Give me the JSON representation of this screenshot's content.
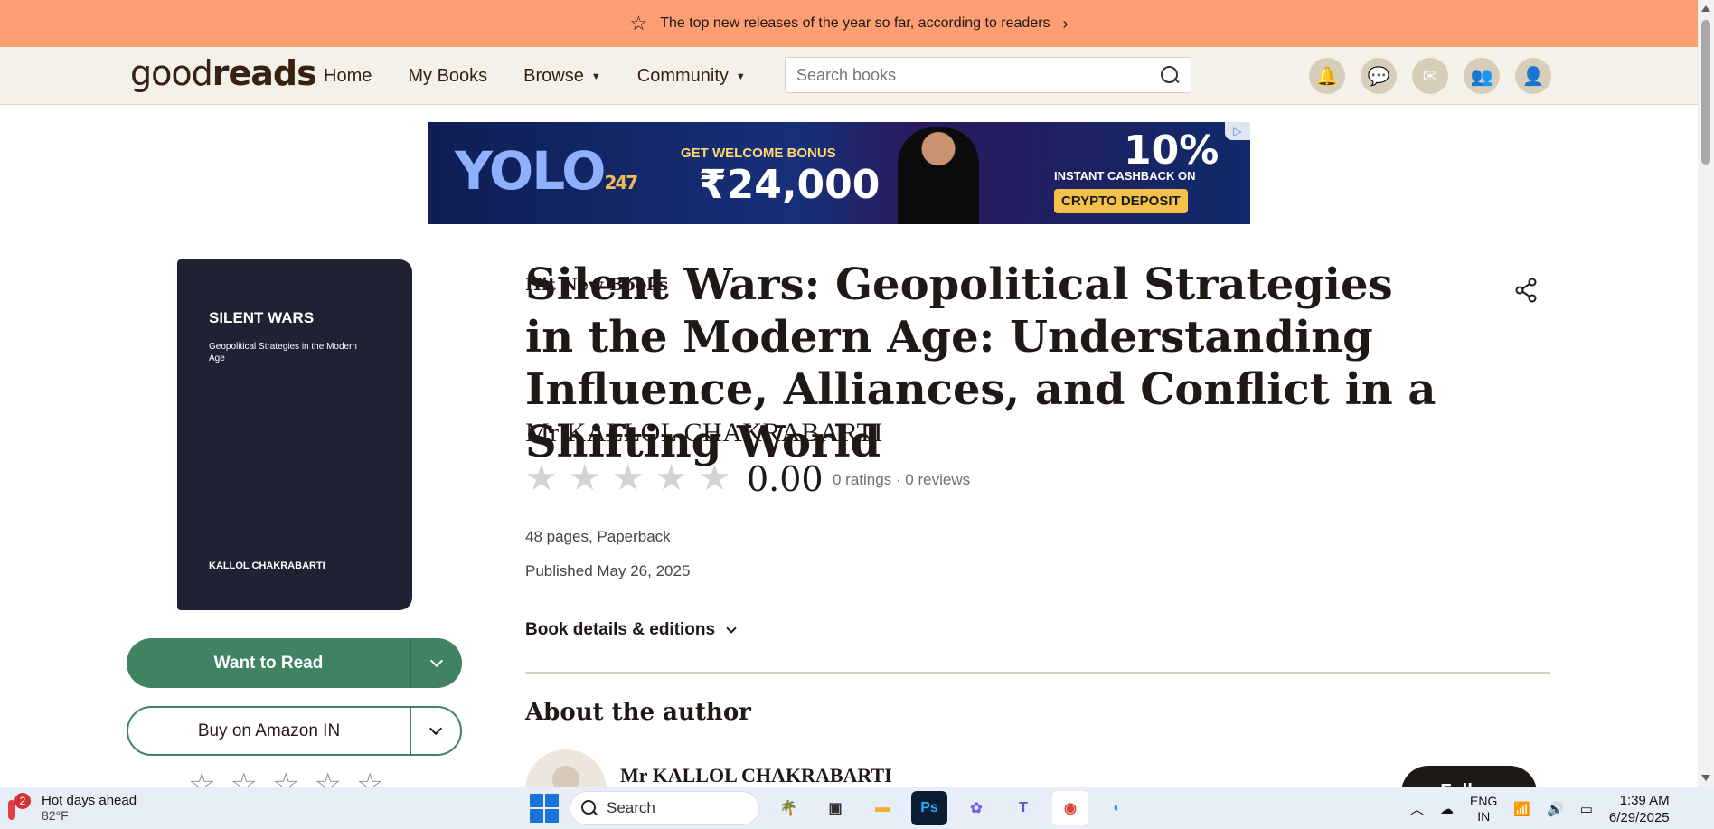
{
  "promo": {
    "title": "Hit New Books",
    "subtitle": "The top new releases of the year so far, according to readers"
  },
  "header": {
    "logo_light": "good",
    "logo_bold": "reads",
    "nav": [
      "Home",
      "My Books",
      "Browse",
      "Community"
    ],
    "search_placeholder": "Search books",
    "icons": [
      "notifications-icon",
      "discussions-icon",
      "messages-icon",
      "friends-icon",
      "profile-icon"
    ]
  },
  "ad": {
    "brand": "YOLO",
    "brand_suffix": "247",
    "bonus_label": "GET WELCOME BONUS",
    "bonus_amount": "₹24,000",
    "cashback_pct": "10%",
    "cashback_label": "INSTANT CASHBACK ON",
    "cashback_cta": "CRYPTO DEPOSIT"
  },
  "cover": {
    "title": "SILENT WARS",
    "subtitle": "Geopolitical Strategies in the Modern Age",
    "author": "KALLOL CHAKRABARTI"
  },
  "actions": {
    "want_to_read": "Want to Read",
    "buy": "Buy on Amazon IN"
  },
  "book": {
    "title": "Silent Wars: Geopolitical Strategies in the Modern Age: Understanding Influence, Alliances, and Conflict in a Shifting World",
    "author": "Mr KALLOL CHAKRABARTI",
    "average_rating": "0.00",
    "rating_fraction": 0,
    "ratings_text": "0 ratings · 0 reviews",
    "pages_format": "48 pages, Paperback",
    "published": "Published May 26, 2025",
    "details_link": "Book details & editions"
  },
  "about": {
    "heading": "About the author",
    "author_name": "Mr KALLOL CHAKRABARTI",
    "follow_label": "Follow"
  },
  "taskbar": {
    "weather_badge": "2",
    "weather_title": "Hot days ahead",
    "weather_temp": "82°F",
    "search_label": "Search",
    "lang_line1": "ENG",
    "lang_line2": "IN",
    "time": "1:39 AM",
    "date": "6/29/2025"
  },
  "colors": {
    "promo_bg": "#ff9e73",
    "header_bg": "#f4f1ea",
    "primary_green": "#3f8363",
    "cover_bg": "#1e2233"
  }
}
